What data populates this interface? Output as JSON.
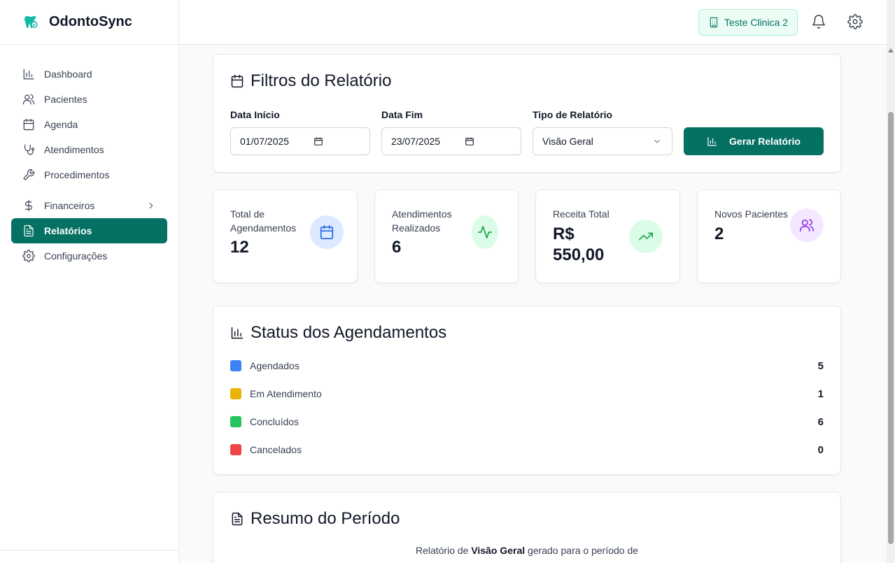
{
  "app": {
    "name": "OdontoSync"
  },
  "colors": {
    "primary": "#047163",
    "accent_bg": "#ecfdf5"
  },
  "sidebar": {
    "items": [
      {
        "label": "Dashboard",
        "icon": "bar-chart-icon"
      },
      {
        "label": "Pacientes",
        "icon": "users-icon"
      },
      {
        "label": "Agenda",
        "icon": "calendar-icon"
      },
      {
        "label": "Atendimentos",
        "icon": "stethoscope-icon"
      },
      {
        "label": "Procedimentos",
        "icon": "wrench-icon"
      },
      {
        "label": "Financeiros",
        "icon": "dollar-icon"
      },
      {
        "label": "Relatórios",
        "icon": "file-text-icon",
        "active": true
      },
      {
        "label": "Configurações",
        "icon": "gear-icon"
      }
    ]
  },
  "header": {
    "clinic_name": "Teste Clinica 2"
  },
  "filters": {
    "title": "Filtros do Relatório",
    "start_label": "Data Início",
    "start_value": "01/07/2025",
    "end_label": "Data Fim",
    "end_value": "23/07/2025",
    "type_label": "Tipo de Relatório",
    "type_value": "Visão Geral",
    "generate_label": "Gerar Relatório"
  },
  "stats": [
    {
      "label_line1": "Total de",
      "label_line2": "Agendamentos",
      "value": "12",
      "color": "#2563eb",
      "bg": "#dbeafe"
    },
    {
      "label_line1": "Atendimentos",
      "label_line2": "Realizados",
      "value": "6",
      "color": "#16a34a",
      "bg": "#dcfce7"
    },
    {
      "label_line1": "Receita Total",
      "value_line1": "R$",
      "value_line2": "550,00",
      "color": "#16a34a",
      "bg": "#dcfce7"
    },
    {
      "label_line1": "Novos Pacientes",
      "value": "2",
      "color": "#9333ea",
      "bg": "#f3e8ff"
    }
  ],
  "status": {
    "title": "Status dos Agendamentos",
    "rows": [
      {
        "label": "Agendados",
        "count": "5",
        "color": "#3b82f6"
      },
      {
        "label": "Em Atendimento",
        "count": "1",
        "color": "#eab308"
      },
      {
        "label": "Concluídos",
        "count": "6",
        "color": "#22c55e"
      },
      {
        "label": "Cancelados",
        "count": "0",
        "color": "#ef4444"
      }
    ]
  },
  "summary": {
    "title": "Resumo do Período",
    "text_prefix": "Relatório de",
    "text_bold": "Visão Geral",
    "text_suffix": "gerado para o período de"
  }
}
